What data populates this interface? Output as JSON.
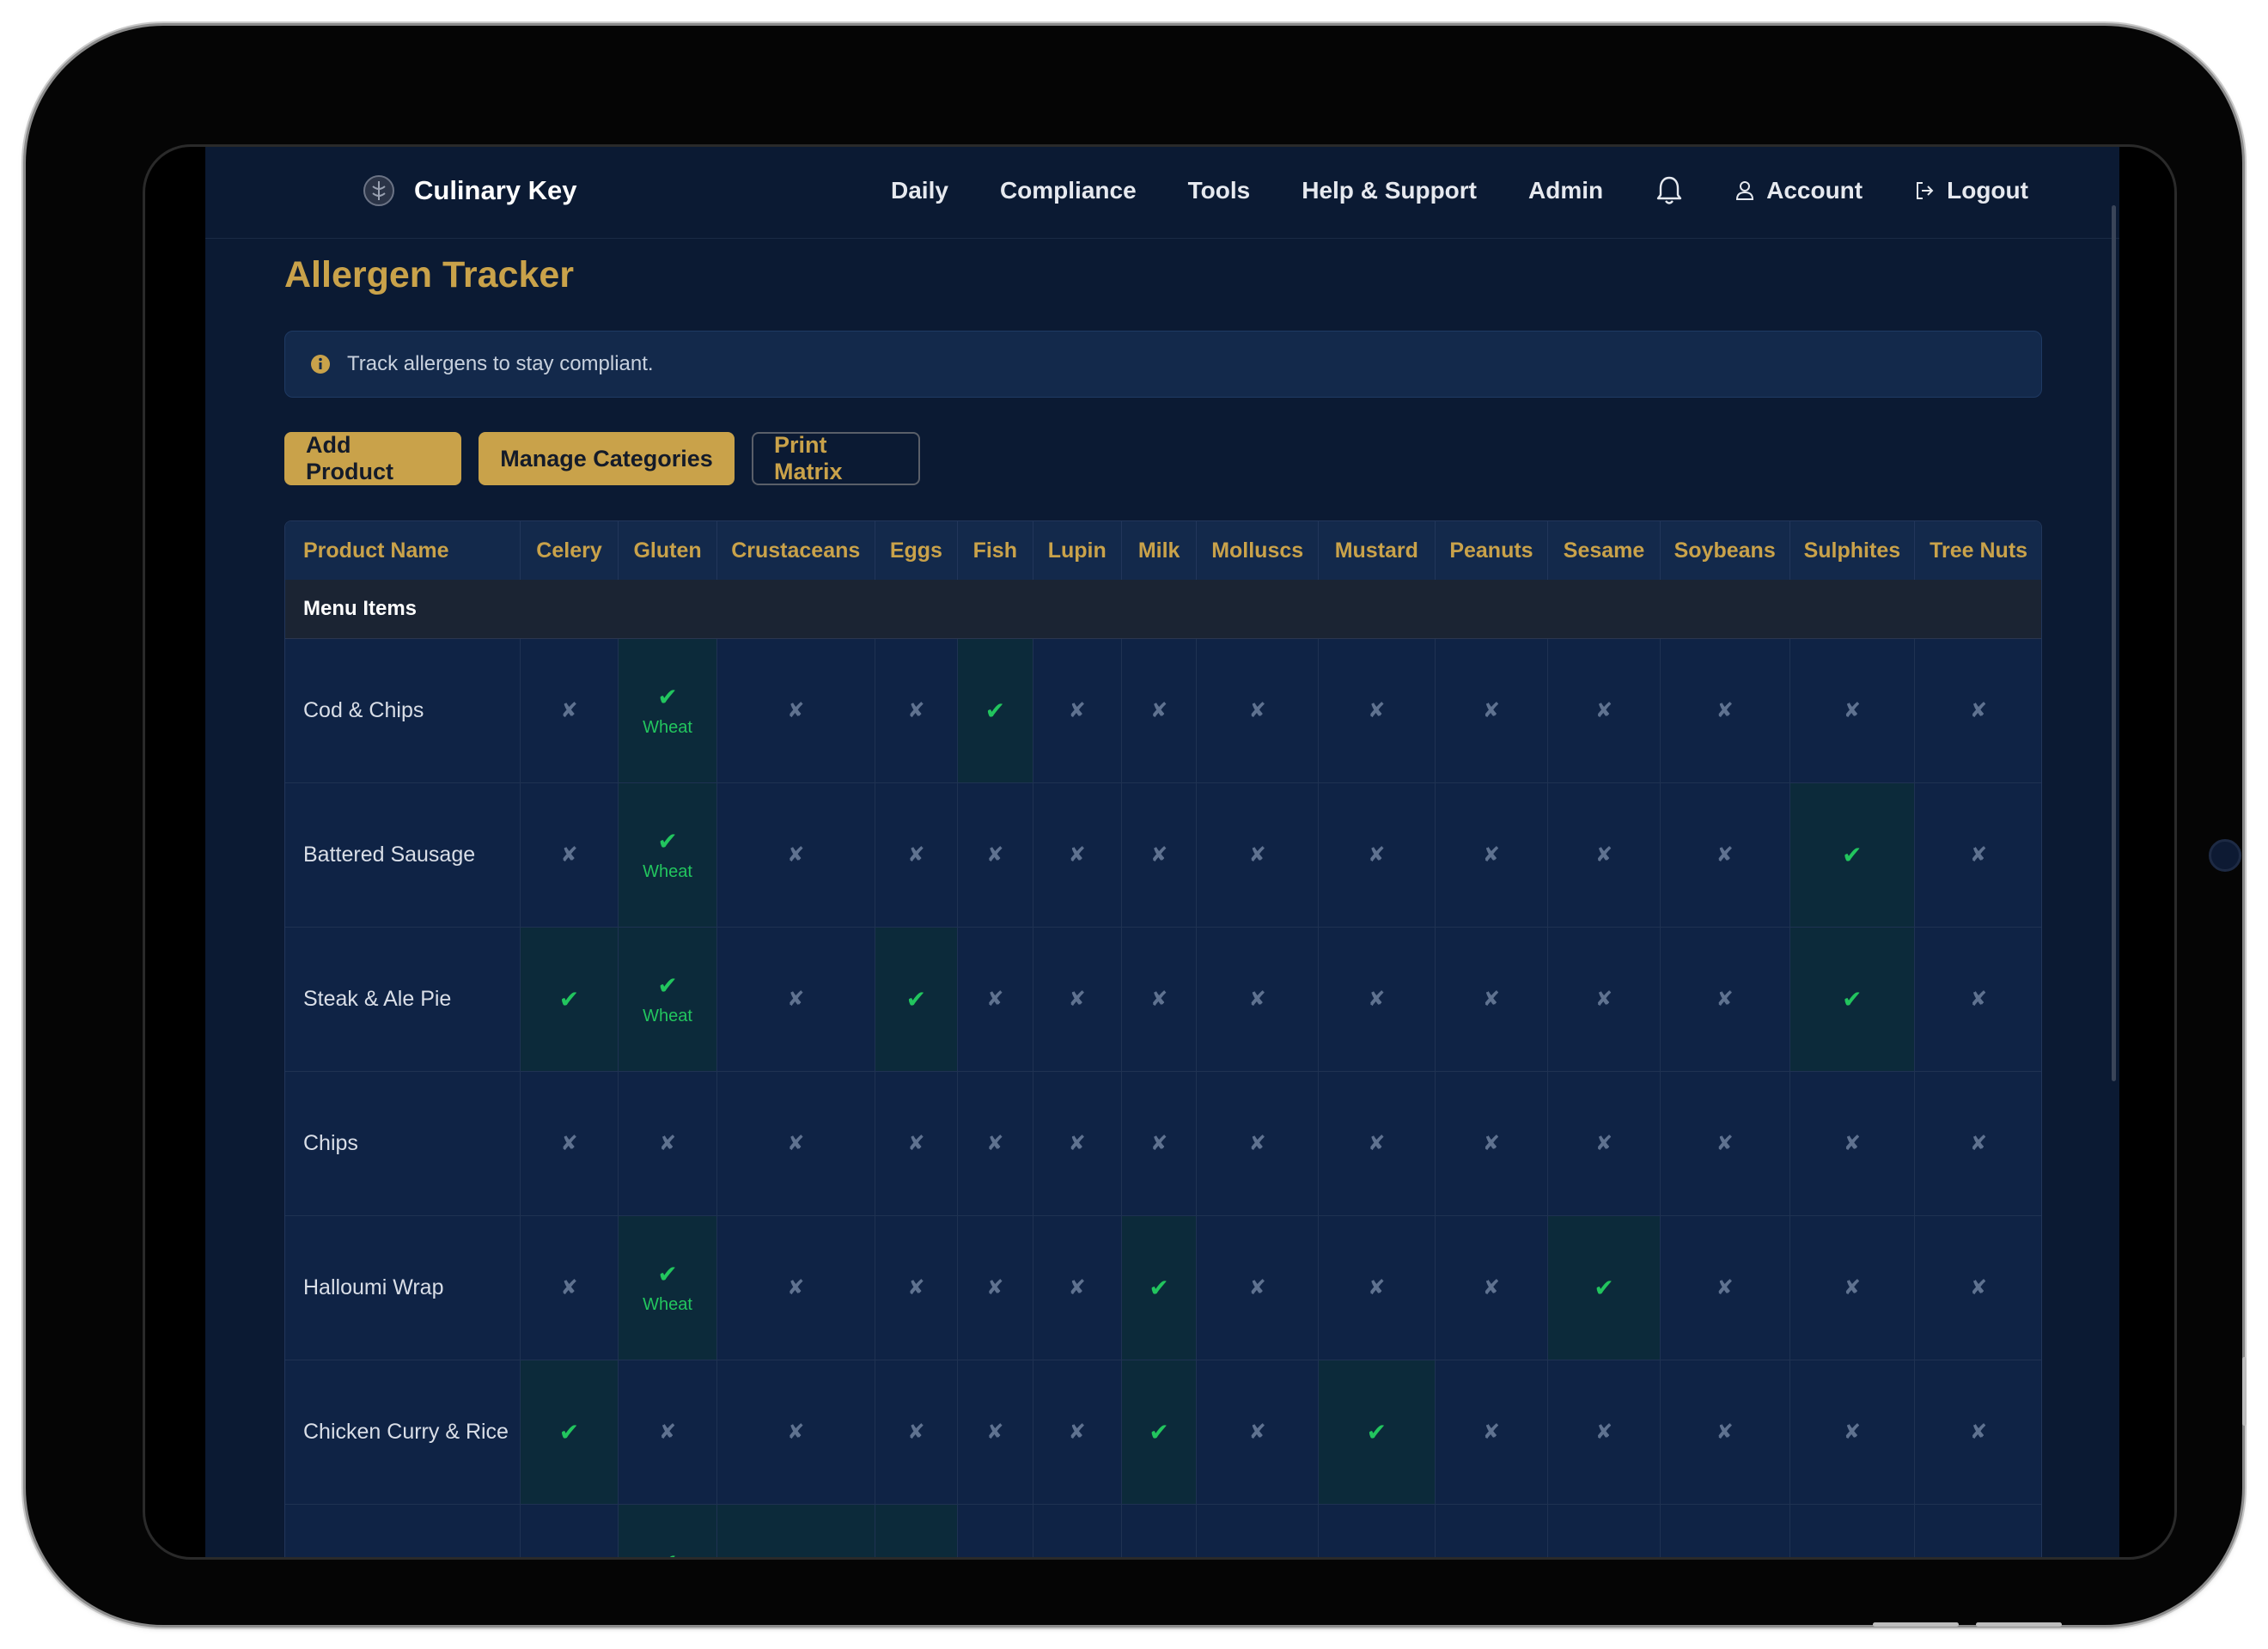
{
  "nav": {
    "brand": "Culinary Key",
    "links": [
      "Daily",
      "Compliance",
      "Tools",
      "Help & Support",
      "Admin"
    ],
    "account": "Account",
    "logout": "Logout"
  },
  "page": {
    "title": "Allergen Tracker",
    "alert": "Track allergens to stay compliant."
  },
  "buttons": {
    "add_product": "Add Product",
    "manage_categories": "Manage Categories",
    "print_matrix": "Print Matrix"
  },
  "table": {
    "columns": [
      "Product Name",
      "Celery",
      "Gluten",
      "Crustaceans",
      "Eggs",
      "Fish",
      "Lupin",
      "Milk",
      "Molluscs",
      "Mustard",
      "Peanuts",
      "Sesame",
      "Soybeans",
      "Sulphites",
      "Tree Nuts"
    ],
    "category": "Menu Items",
    "check_symbol": "✔",
    "cross_symbol": "✘",
    "gluten_note": "Wheat",
    "rows": [
      {
        "name": "Cod & Chips",
        "allergens": [
          "Gluten",
          "Fish"
        ]
      },
      {
        "name": "Battered Sausage",
        "allergens": [
          "Gluten",
          "Sulphites"
        ]
      },
      {
        "name": "Steak & Ale Pie",
        "allergens": [
          "Celery",
          "Gluten",
          "Eggs",
          "Sulphites"
        ]
      },
      {
        "name": "Chips",
        "allergens": []
      },
      {
        "name": "Halloumi Wrap",
        "allergens": [
          "Gluten",
          "Milk",
          "Sesame"
        ]
      },
      {
        "name": "Chicken Curry & Rice",
        "allergens": [
          "Celery",
          "Milk",
          "Mustard"
        ]
      },
      {
        "name": "",
        "allergens": [
          "Gluten",
          "Crustaceans",
          "Eggs"
        ]
      }
    ]
  },
  "colors": {
    "background": "#0b1a33",
    "accent": "#c9a24a",
    "check": "#22c55e",
    "cell_highlight": "#0c2a3a"
  }
}
